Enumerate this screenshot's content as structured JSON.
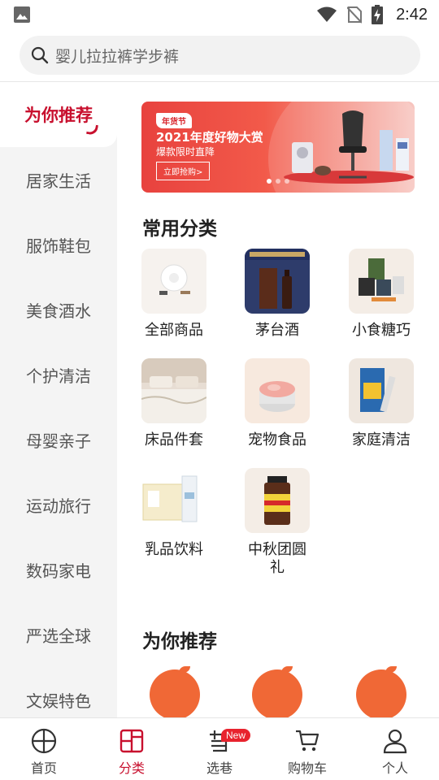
{
  "status_bar": {
    "time": "2:42"
  },
  "search": {
    "placeholder": "婴儿拉拉裤学步裤"
  },
  "sidebar": {
    "active_label": "为你推荐",
    "items": [
      "居家生活",
      "服饰鞋包",
      "美食酒水",
      "个护清洁",
      "母婴亲子",
      "运动旅行",
      "数码家电",
      "严选全球",
      "文娱特色"
    ]
  },
  "banner": {
    "tag": "年货节",
    "title": "2021年度好物大赏",
    "subtitle": "爆款限时直降",
    "button": "立即抢购>",
    "current_slide": 1,
    "total_slides": 3
  },
  "common_categories": {
    "title": "常用分类",
    "items": [
      {
        "label": "全部商品",
        "icon": "pillow-products-image"
      },
      {
        "label": "茅台酒",
        "icon": "baijiu-bottle-image"
      },
      {
        "label": "小食糖巧",
        "icon": "snacks-image"
      },
      {
        "label": "床品件套",
        "icon": "bedding-image"
      },
      {
        "label": "宠物食品",
        "icon": "pet-food-can-image"
      },
      {
        "label": "家庭清洁",
        "icon": "cleaning-wipes-image"
      },
      {
        "label": "乳品饮料",
        "icon": "milk-box-image"
      },
      {
        "label": "中秋团圆礼",
        "icon": "supplement-bottle-image"
      }
    ]
  },
  "recommend": {
    "title": "为你推荐"
  },
  "tabbar": {
    "items": [
      {
        "label": "首页",
        "icon": "home-ball-icon"
      },
      {
        "label": "分类",
        "icon": "category-icon"
      },
      {
        "label": "选巷",
        "icon": "alley-icon"
      },
      {
        "label": "购物车",
        "icon": "cart-icon"
      },
      {
        "label": "个人",
        "icon": "person-icon"
      }
    ],
    "active_index": 1,
    "badge": "New"
  },
  "colors": {
    "brand_red": "#c8102e",
    "sidebar_bg": "#f4f4f4",
    "search_bg": "#f2f2f2"
  }
}
